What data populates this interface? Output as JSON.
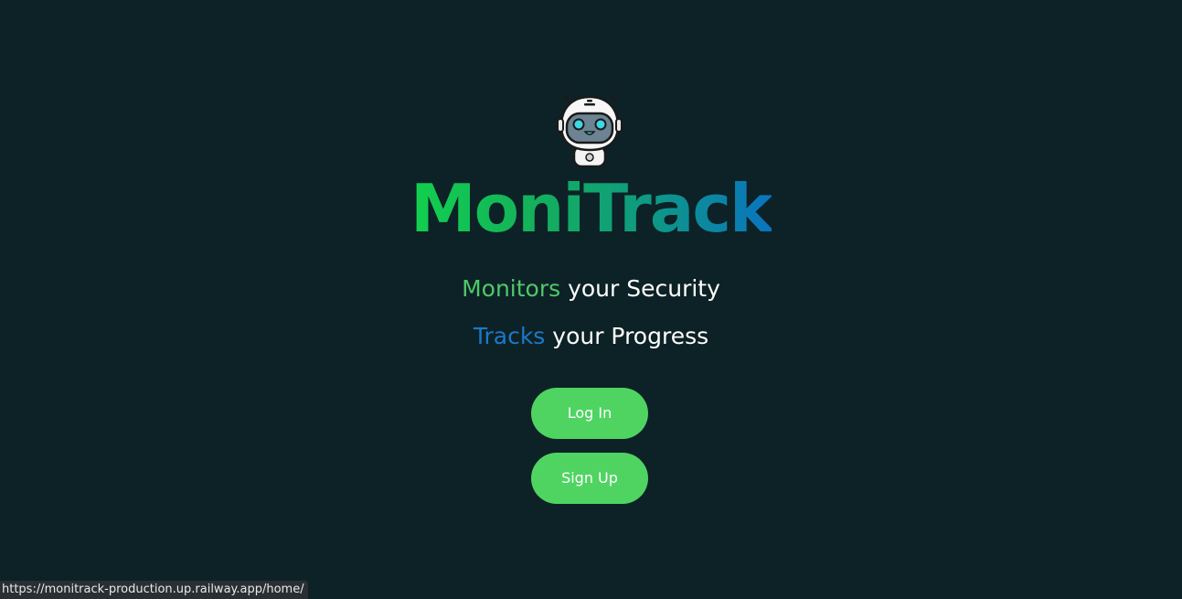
{
  "brand": {
    "logo": "robot-mascot-icon",
    "name": "MoniTrack",
    "gradient": [
      "#12d04e",
      "#0a74c0"
    ]
  },
  "taglines": [
    {
      "accent": "Monitors",
      "rest": " your Security",
      "accent_color": "#4fc86a"
    },
    {
      "accent": "Tracks",
      "rest": " your Progress",
      "accent_color": "#1d78c8"
    }
  ],
  "buttons": {
    "login": "Log In",
    "signup": "Sign Up",
    "color": "#4fd462"
  },
  "status_bar": {
    "url": "https://monitrack-production.up.railway.app/home/"
  },
  "colors": {
    "background": "#0d2226"
  }
}
